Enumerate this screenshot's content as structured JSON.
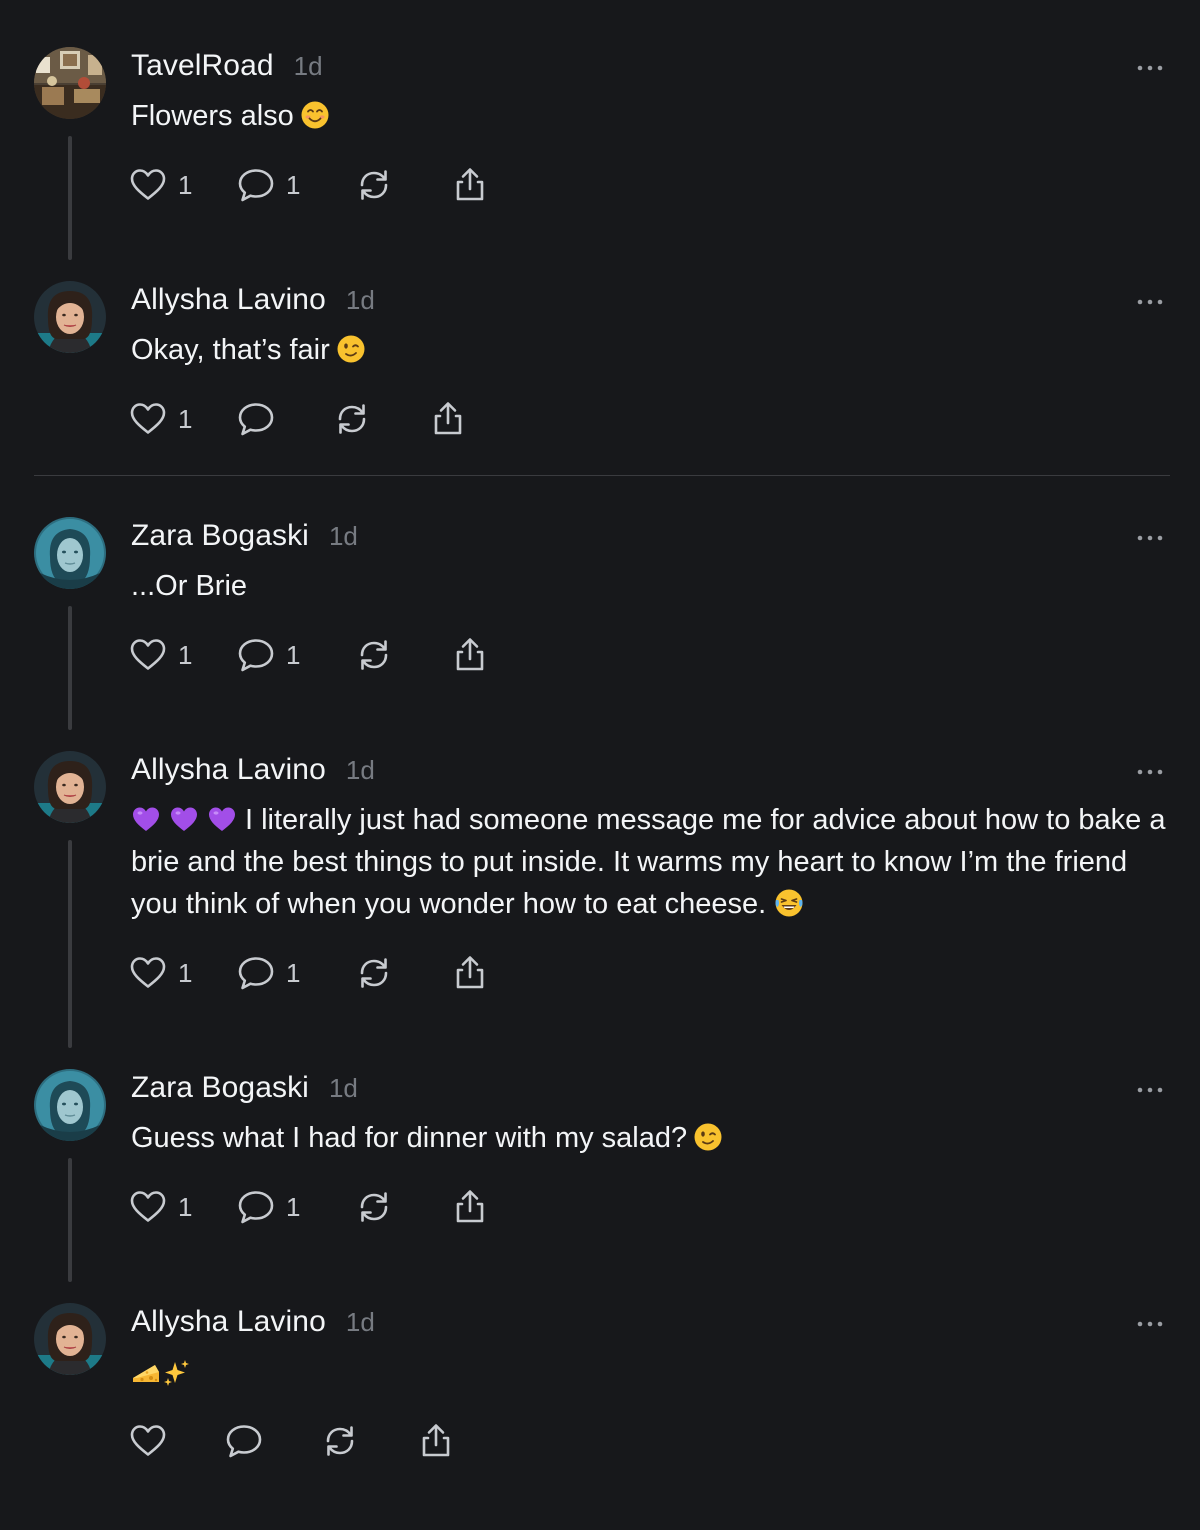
{
  "colors": {
    "background": "#17181b",
    "text": "#f3f5f7",
    "muted": "#777b82",
    "thread_line": "#3a3b3f",
    "icon": "#c8cbd0"
  },
  "posts": [
    {
      "author": "TavelRoad",
      "time": "1d",
      "text": "Flowers also",
      "trailing_emoji": "smiling-face-emoji",
      "likes": "1",
      "replies": "1",
      "avatar": "travelroad-avatar"
    },
    {
      "author": "Allysha Lavino",
      "time": "1d",
      "text": "Okay, that’s fair",
      "trailing_emoji": "winking-face-emoji",
      "likes": "1",
      "replies": "",
      "avatar": "allysha-avatar"
    },
    {
      "author": "Zara Bogaski",
      "time": "1d",
      "text": "...Or Brie",
      "likes": "1",
      "replies": "1",
      "avatar": "zara-avatar"
    },
    {
      "author": "Allysha Lavino",
      "time": "1d",
      "leading_emojis": [
        "purple-heart-emoji",
        "purple-heart-emoji",
        "purple-heart-emoji"
      ],
      "text": "I literally just had someone message me for advice about how to bake a brie and the best things to put inside. It warms my heart to know I’m the friend you think of when you wonder how to eat cheese.",
      "trailing_emoji": "laughing-tears-emoji",
      "likes": "1",
      "replies": "1",
      "avatar": "allysha-avatar"
    },
    {
      "author": "Zara Bogaski",
      "time": "1d",
      "text": "Guess what I had for dinner with my salad?",
      "trailing_emoji": "winking-face-emoji",
      "likes": "1",
      "replies": "1",
      "avatar": "zara-avatar"
    },
    {
      "author": "Allysha Lavino",
      "time": "1d",
      "text": "",
      "emojis": [
        "cheese-emoji",
        "sparkles-emoji"
      ],
      "likes": "",
      "replies": "",
      "avatar": "allysha-avatar"
    }
  ]
}
